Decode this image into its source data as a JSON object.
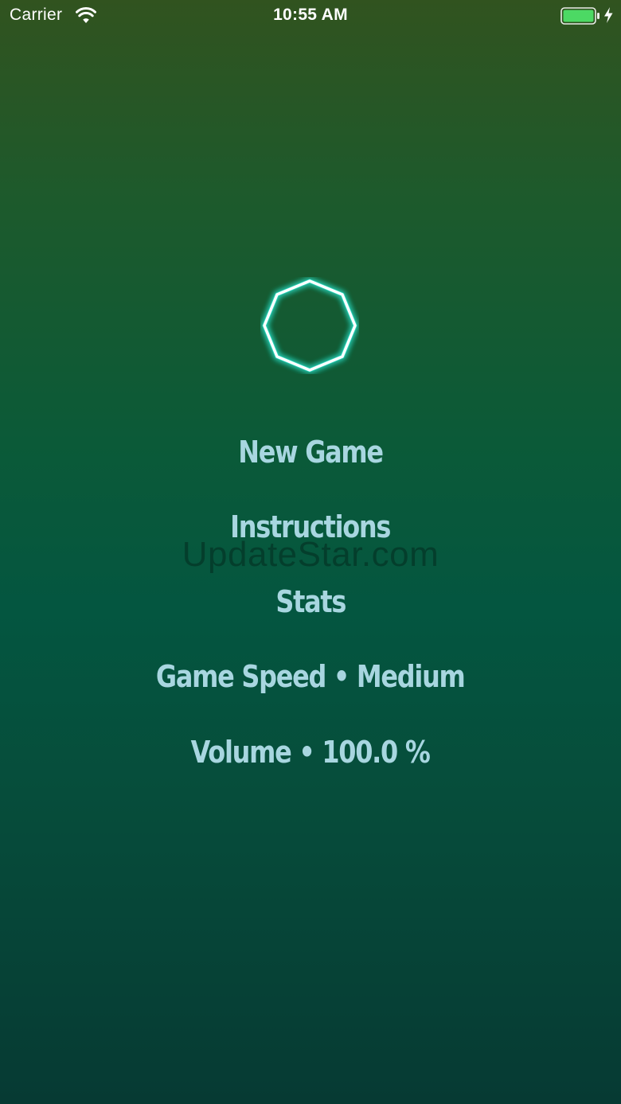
{
  "status_bar": {
    "carrier": "Carrier",
    "time": "10:55 AM",
    "battery_level": 1.0,
    "charging": true,
    "battery_color": "#4cd964"
  },
  "logo": {
    "icon": "octagon-icon",
    "stroke_color": "#ffffff",
    "glow_color": "#2ee6d0"
  },
  "menu": {
    "new_game": "New Game",
    "instructions": "Instructions",
    "stats": "Stats",
    "game_speed": "Game Speed • Medium",
    "volume": "Volume • 100.0 %",
    "text_color": "#a8d6e0"
  },
  "watermark": {
    "text": "UpdateStar.com"
  }
}
